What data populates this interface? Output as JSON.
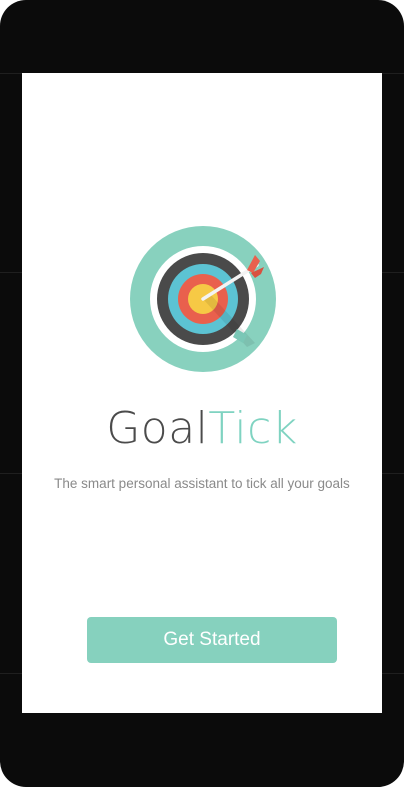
{
  "app": {
    "title_part1": "Goal",
    "title_part2": "Tick",
    "tagline": "The smart personal assistant to tick all your goals"
  },
  "actions": {
    "primary_label": "Get Started"
  },
  "icons": {
    "logo": "target-with-arrow-icon"
  },
  "colors": {
    "brand": "#86d1be",
    "title_dark": "#4b4b4b",
    "title_accent": "#7fd3c1",
    "tagline": "#8a8a8a"
  }
}
